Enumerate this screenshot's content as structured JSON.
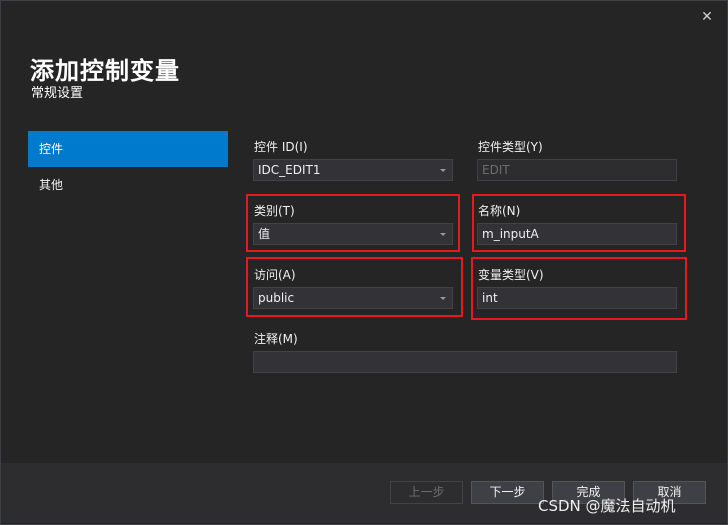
{
  "window": {
    "close_glyph": "✕",
    "title": "添加控制变量",
    "subtitle": "常规设置"
  },
  "nav": {
    "items": [
      {
        "label": "控件",
        "active": true
      },
      {
        "label": "其他",
        "active": false
      }
    ]
  },
  "form": {
    "control_id": {
      "label": "控件 ID(I)",
      "value": "IDC_EDIT1"
    },
    "control_type": {
      "label": "控件类型(Y)",
      "value": "EDIT"
    },
    "category": {
      "label": "类别(T)",
      "value": "值"
    },
    "name": {
      "label": "名称(N)",
      "value": "m_inputA"
    },
    "access": {
      "label": "访问(A)",
      "value": "public"
    },
    "var_type": {
      "label": "变量类型(V)",
      "value": "int"
    },
    "comment": {
      "label": "注释(M)",
      "value": ""
    }
  },
  "buttons": {
    "prev": "上一步",
    "next": "下一步",
    "finish": "完成",
    "cancel": "取消"
  },
  "watermark": "CSDN @魔法自动机",
  "colors": {
    "accent": "#007acc",
    "highlight": "#e8191c",
    "background": "#252526"
  }
}
